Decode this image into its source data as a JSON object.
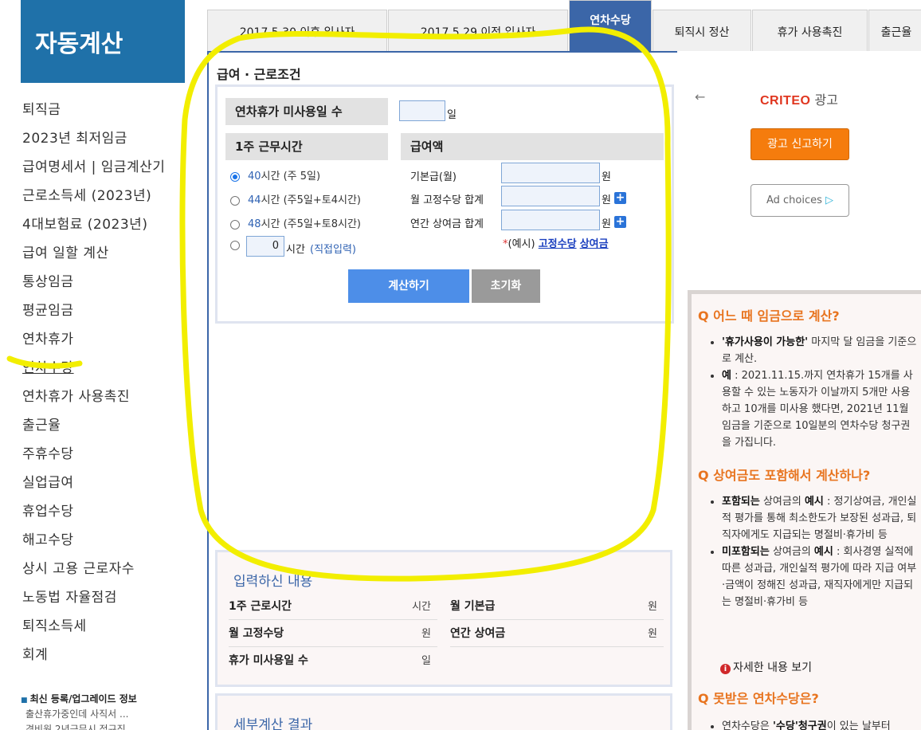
{
  "sidebar": {
    "logo": "자동계산",
    "items": [
      {
        "label": "퇴직금"
      },
      {
        "label": "2023년 최저임금"
      },
      {
        "label": "급여명세서 | 임금계산기"
      },
      {
        "label": "근로소득세 (2023년)"
      },
      {
        "label": "4대보험료 (2023년)"
      },
      {
        "label": "급여 일할 계산"
      },
      {
        "label": "통상임금"
      },
      {
        "label": "평균임금"
      },
      {
        "label": "연차휴가"
      },
      {
        "label": "연차수당"
      },
      {
        "label": "연차휴가 사용촉진"
      },
      {
        "label": "출근율"
      },
      {
        "label": "주휴수당"
      },
      {
        "label": "실업급여"
      },
      {
        "label": "휴업수당"
      },
      {
        "label": "해고수당"
      },
      {
        "label": "상시 고용 근로자수"
      },
      {
        "label": "노동법 자율점검"
      },
      {
        "label": "퇴직소득세"
      },
      {
        "label": "회계"
      }
    ],
    "news_title": "최신 등록/업그레이드 정보",
    "news_items": [
      "출산휴가중인데 사직서 ...",
      "경비원 2년근무시 정규직..."
    ]
  },
  "tabs": [
    {
      "label": "2017.5.30 이후 입사자"
    },
    {
      "label": "2017.5.29 이전 입사자"
    },
    {
      "label": "연차수당"
    },
    {
      "label": "퇴직시 정산"
    },
    {
      "label": "휴가 사용촉진"
    },
    {
      "label": "출근율"
    }
  ],
  "form": {
    "section_title": "급여 · 근로조건",
    "unused_leave_label": "연차휴가 미사용일 수",
    "unused_leave_value": "",
    "unused_leave_unit": "일",
    "weekly_hours_label": "1주 근무시간",
    "options": [
      {
        "num": "40",
        "text": "시간 (주 5일)"
      },
      {
        "num": "44",
        "text": "시간 (주5일+토4시간)"
      },
      {
        "num": "48",
        "text": "시간 (주5일+토8시간)"
      }
    ],
    "custom_value": "0",
    "custom_unit": "시간",
    "custom_note": "(직접입력)",
    "pay_label": "급여액",
    "base_pay_label": "기본급(월)",
    "fixed_allowance_label": "월 고정수당 합계",
    "annual_bonus_label": "연간 상여금 합계",
    "won": "원",
    "example_star": "*",
    "example_prefix": "(예시)",
    "example_link1": "고정수당",
    "example_link2": "상여금",
    "calc_button": "계산하기",
    "reset_button": "초기화"
  },
  "result": {
    "title": "입력하신 내용",
    "weekly_hours": "1주 근로시간",
    "weekly_hours_unit": "시간",
    "base_pay": "월 기본급",
    "base_pay_unit": "원",
    "fixed_allowance": "월 고정수당",
    "fixed_allowance_unit": "원",
    "annual_bonus": "연간 상여금",
    "annual_bonus_unit": "원",
    "unused_days": "휴가 미사용일 수",
    "unused_days_unit": "일"
  },
  "detail": {
    "title": "세부계산 결과"
  },
  "ad": {
    "brand": "CRITEO",
    "label": "광고",
    "report_button": "광고 신고하기",
    "choices": "Ad choices"
  },
  "faq": {
    "q1": "Q 어느 때 임금으로 계산?",
    "q1_a1_bold": "'휴가사용이 가능한'",
    "q1_a1_rest": " 마지막 달 임금을 기준으로 계산.",
    "q1_a2_bold": "예",
    "q1_a2_rest": " : 2021.11.15.까지 연차휴가 15개를 사용할 수 있는 노동자가 이날까지 5개만 사용하고 10개를 미사용 했다면, 2021년 11월 임금을 기준으로 10일분의 연차수당 청구권을 가집니다.",
    "q2": "Q 상여금도 포함해서 계산하나?",
    "q2_a1_bold": "포함되는",
    "q2_a1_mid": " 상여금의 ",
    "q2_a1_bold2": "예시",
    "q2_a1_rest": " : 정기상여금, 개인실적 평가를 통해 최소한도가 보장된 성과급, 퇴직자에게도 지급되는 명절비·휴가비 등",
    "q2_a2_bold": "미포함되는",
    "q2_a2_mid": " 상여금의 ",
    "q2_a2_bold2": "예시",
    "q2_a2_rest": " : 회사경영 실적에 따른 성과급, 개인실적 평가에 따라 지급 여부·금액이 정해진 성과급, 재직자에게만 지급되는 명절비·휴가비 등",
    "more": "자세한 내용 보기",
    "q3": "Q 못받은 연차수당은?",
    "q3_a1_pre": "연차수당은 ",
    "q3_a1_bold": "'수당'청구권",
    "q3_a1_rest": "이 있는 날부터"
  }
}
